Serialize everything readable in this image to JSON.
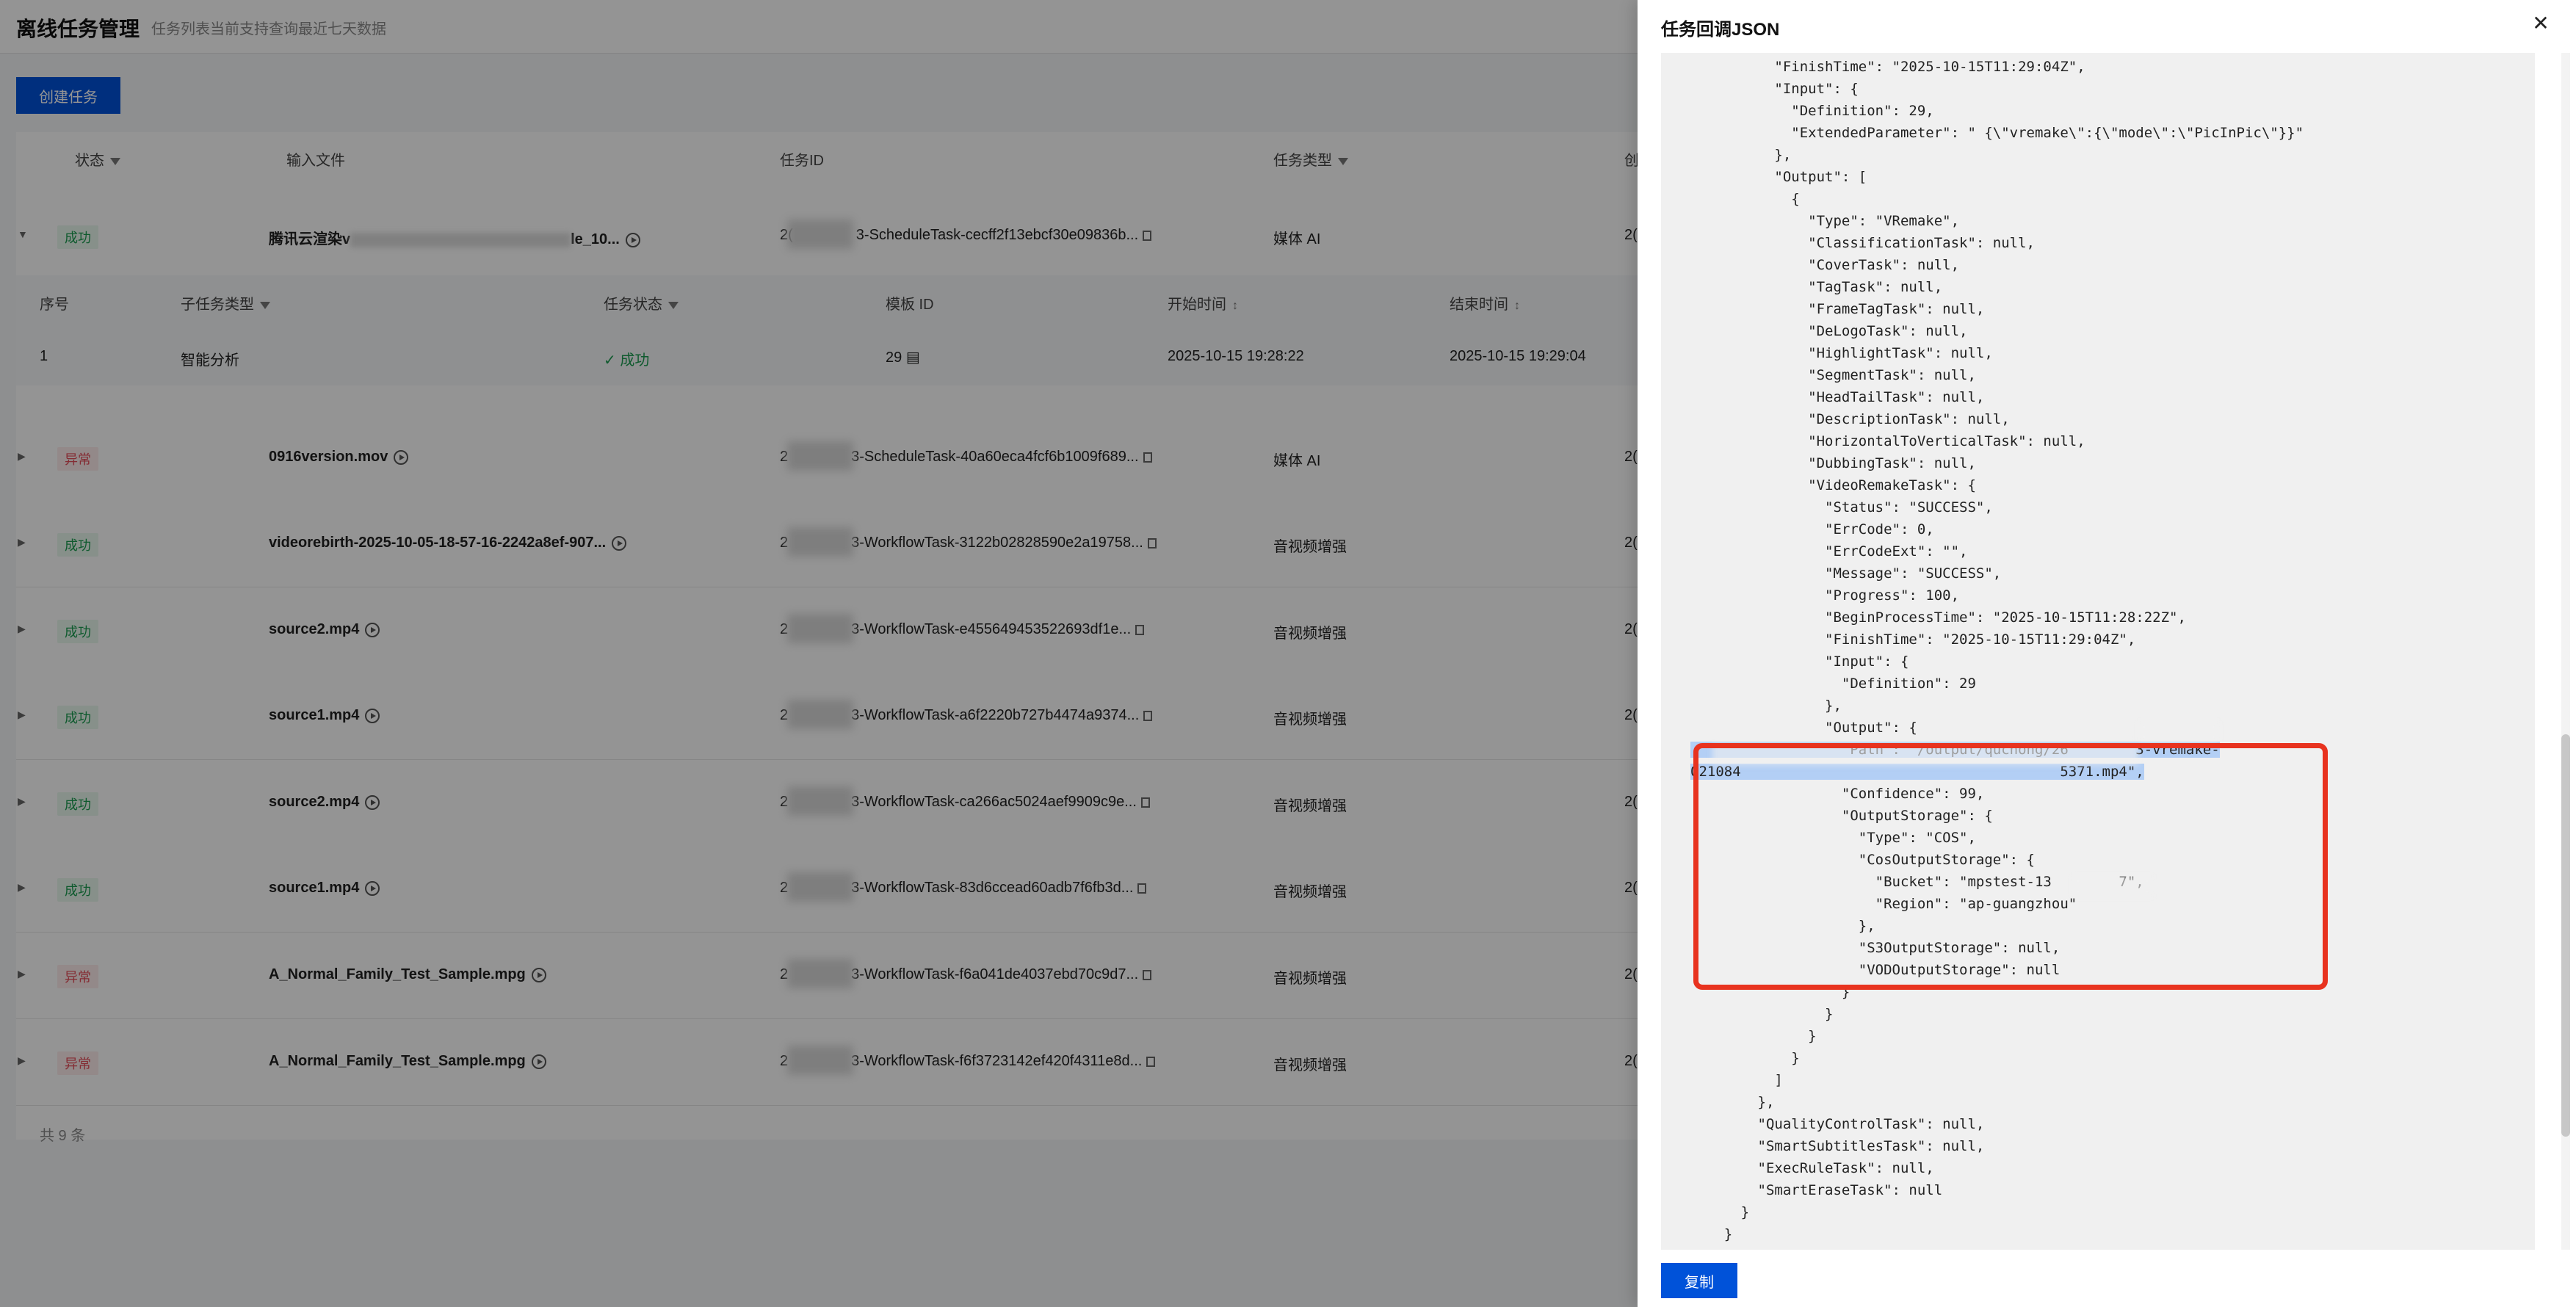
{
  "page": {
    "title": "离线任务管理",
    "subtitle": "任务列表当前支持查询最近七天数据",
    "create_button": "创建任务",
    "columns": [
      "状态",
      "输入文件",
      "任务ID",
      "任务类型",
      "创"
    ],
    "rows": [
      {
        "status": "成功",
        "status_type": "ok",
        "file": "腾讯云渲染v",
        "file_suffix": "le_10...",
        "task_id_prefix": "2(",
        "task_id": "3-ScheduleTask-cecff2f13ebcf30e09836b...",
        "type": "媒体 AI",
        "created": "2("
      },
      {
        "status": "异常",
        "status_type": "err",
        "file": "0916version.mov",
        "file_suffix": "",
        "task_id_prefix": "2",
        "task_id": "3-ScheduleTask-40a60eca4fcf6b1009f689...",
        "type": "媒体 AI",
        "created": "2("
      },
      {
        "status": "成功",
        "status_type": "ok",
        "file": "videorebirth-2025-10-05-18-57-16-2242a8ef-907...",
        "file_suffix": "",
        "task_id_prefix": "2",
        "task_id": "3-WorkflowTask-3122b02828590e2a19758...",
        "type": "音视频增强",
        "created": "2("
      },
      {
        "status": "成功",
        "status_type": "ok",
        "file": "source2.mp4",
        "file_suffix": "",
        "task_id_prefix": "2",
        "task_id": "3-WorkflowTask-e455649453522693df1e...",
        "type": "音视频增强",
        "created": "2("
      },
      {
        "status": "成功",
        "status_type": "ok",
        "file": "source1.mp4",
        "file_suffix": "",
        "task_id_prefix": "2",
        "task_id": "3-WorkflowTask-a6f2220b727b4474a9374...",
        "type": "音视频增强",
        "created": "2("
      },
      {
        "status": "成功",
        "status_type": "ok",
        "file": "source2.mp4",
        "file_suffix": "",
        "task_id_prefix": "2",
        "task_id": "3-WorkflowTask-ca266ac5024aef9909c9e...",
        "type": "音视频增强",
        "created": "2("
      },
      {
        "status": "成功",
        "status_type": "ok",
        "file": "source1.mp4",
        "file_suffix": "",
        "task_id_prefix": "2",
        "task_id": "3-WorkflowTask-83d6ccead60adb7f6fb3d...",
        "type": "音视频增强",
        "created": "2("
      },
      {
        "status": "异常",
        "status_type": "err",
        "file": "A_Normal_Family_Test_Sample.mpg",
        "file_suffix": "",
        "task_id_prefix": "2",
        "task_id": "3-WorkflowTask-f6a041de4037ebd70c9d7...",
        "type": "音视频增强",
        "created": "2("
      },
      {
        "status": "异常",
        "status_type": "err",
        "file": "A_Normal_Family_Test_Sample.mpg",
        "file_suffix": "",
        "task_id_prefix": "2",
        "task_id": "3-WorkflowTask-f6f3723142ef420f4311e8d...",
        "type": "音视频增强",
        "created": "2("
      }
    ],
    "subtable": {
      "columns": [
        "序号",
        "子任务类型",
        "任务状态",
        "模板 ID",
        "开始时间",
        "结束时间"
      ],
      "row": {
        "index": "1",
        "type": "智能分析",
        "status": "成功",
        "template_id": "29",
        "start": "2025-10-15 19:28:22",
        "end": "2025-10-15 19:29:04"
      }
    },
    "total": "共 9 条"
  },
  "drawer": {
    "title": "任务回调JSON",
    "copy_button": "复制",
    "code_lines": [
      "          \"FinishTime\": \"2025-10-15T11:29:04Z\",",
      "          \"Input\": {",
      "            \"Definition\": 29,",
      "            \"ExtendedParameter\": \" {\\\"vremake\\\":{\\\"mode\\\":\\\"PicInPic\\\"}}\"",
      "          },",
      "          \"Output\": [",
      "            {",
      "              \"Type\": \"VRemake\",",
      "              \"ClassificationTask\": null,",
      "              \"CoverTask\": null,",
      "              \"TagTask\": null,",
      "              \"FrameTagTask\": null,",
      "              \"DeLogoTask\": null,",
      "              \"HighlightTask\": null,",
      "              \"SegmentTask\": null,",
      "              \"HeadTailTask\": null,",
      "              \"DescriptionTask\": null,",
      "              \"HorizontalToVerticalTask\": null,",
      "              \"DubbingTask\": null,",
      "              \"VideoRemakeTask\": {",
      "                \"Status\": \"SUCCESS\",",
      "                \"ErrCode\": 0,",
      "                \"ErrCodeExt\": \"\",",
      "                \"Message\": \"SUCCESS\",",
      "                \"Progress\": 100,",
      "                \"BeginProcessTime\": \"2025-10-15T11:28:22Z\",",
      "                \"FinishTime\": \"2025-10-15T11:29:04Z\",",
      "                \"Input\": {",
      "                  \"Definition\": 29",
      "                },",
      "                \"Output\": {",
      "                  \"Path\": \"/output/quchong/26        3-vremake-",
      "021084                                      5371.mp4\",",
      "                  \"Confidence\": 99,",
      "                  \"OutputStorage\": {",
      "                    \"Type\": \"COS\",",
      "                    \"CosOutputStorage\": {",
      "                      \"Bucket\": \"mpstest-13        7\",",
      "                      \"Region\": \"ap-guangzhou\"",
      "                    },",
      "                    \"S3OutputStorage\": null,",
      "                    \"VODOutputStorage\": null",
      "                  }",
      "                }",
      "              }",
      "            }",
      "          ]",
      "        },",
      "        \"QualityControlTask\": null,",
      "        \"SmartSubtitlesTask\": null,",
      "        \"ExecRuleTask\": null,",
      "        \"SmartEraseTask\": null",
      "      }",
      "    }",
      "  ]"
    ],
    "highlighted_lines": [
      31,
      32
    ]
  },
  "colors": {
    "accent": "#0052d9",
    "success": "#1a9c50",
    "error": "#e34d59",
    "annotation_box": "#e8331f"
  }
}
